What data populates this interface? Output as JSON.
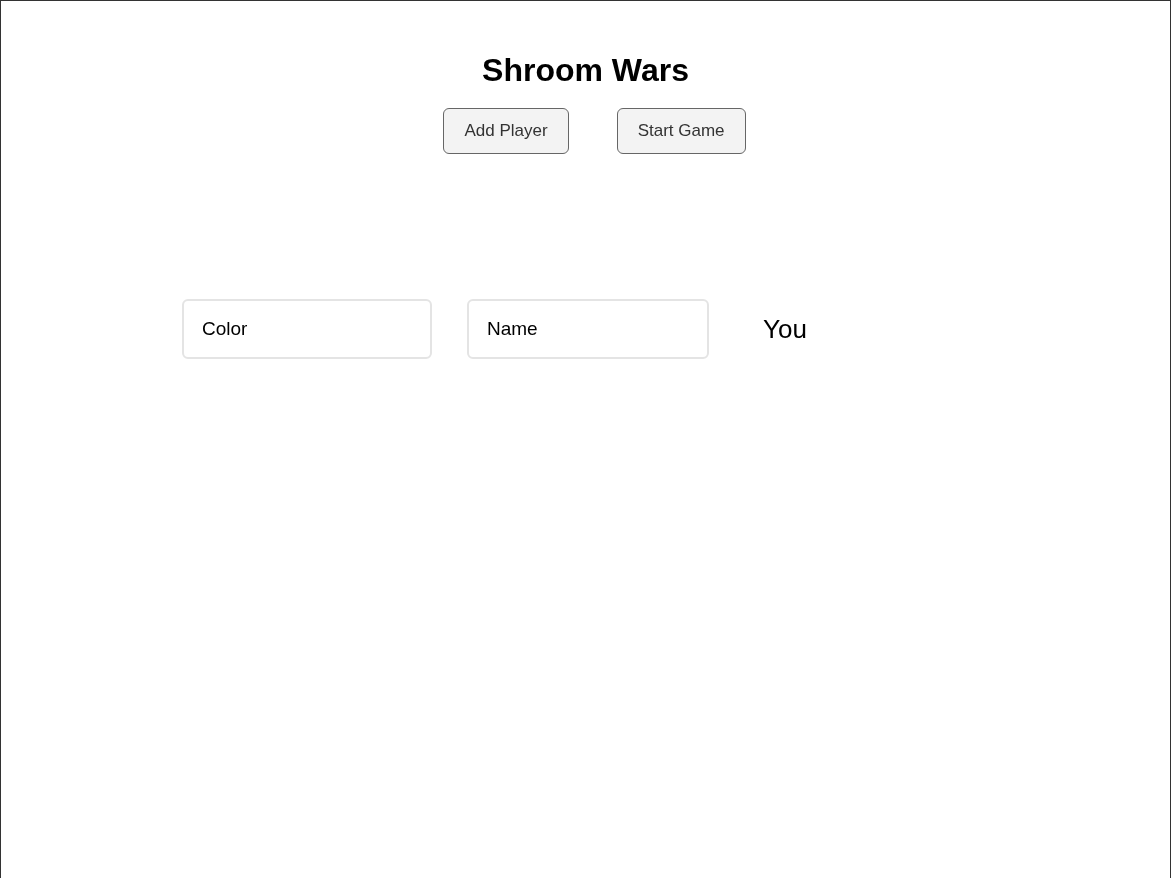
{
  "title": "Shroom Wars",
  "buttons": [
    {
      "label": "Add Player"
    },
    {
      "label": "Start Game"
    }
  ],
  "players": [
    {
      "color_field": "Color",
      "name_field": "Name",
      "tag": "You"
    }
  ]
}
